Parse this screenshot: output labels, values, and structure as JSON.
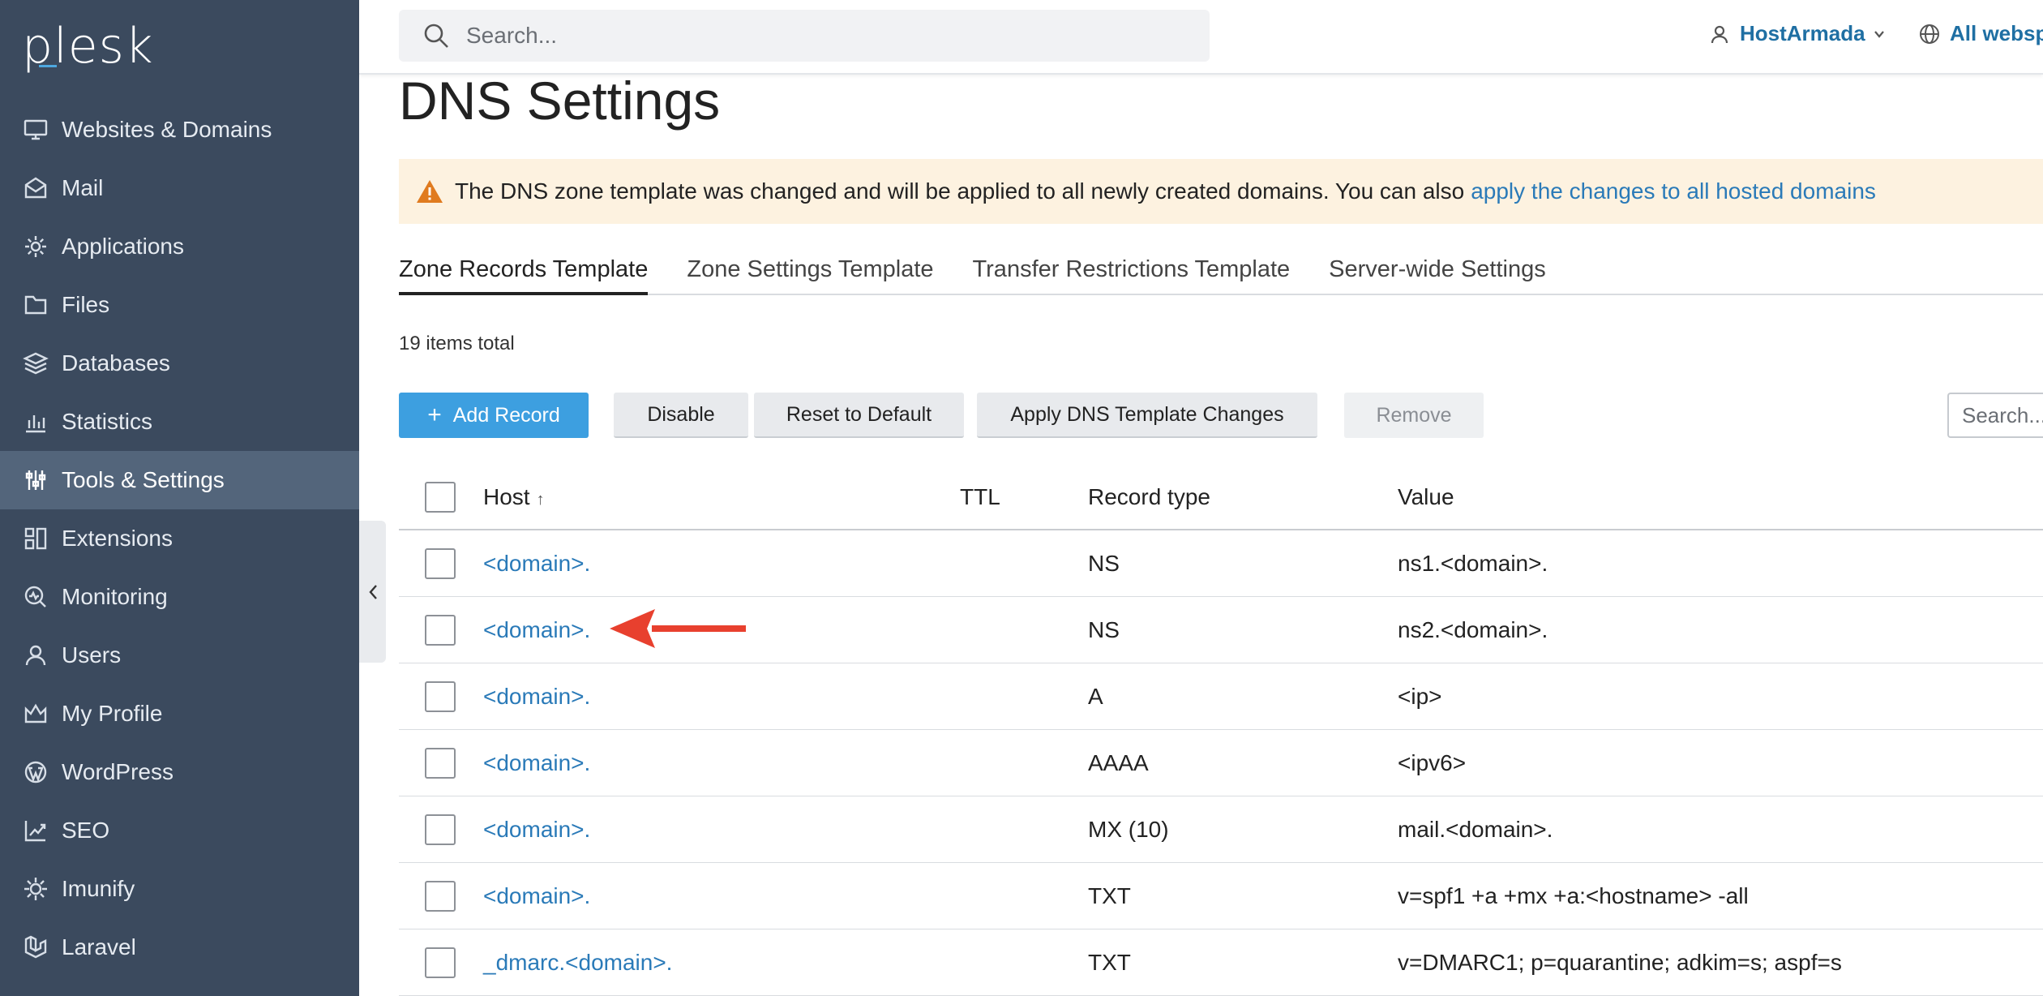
{
  "app": {
    "logo": "plesk"
  },
  "sidebar": {
    "items": [
      {
        "label": "Websites & Domains",
        "icon": "monitor-icon"
      },
      {
        "label": "Mail",
        "icon": "mail-icon"
      },
      {
        "label": "Applications",
        "icon": "gear-icon"
      },
      {
        "label": "Files",
        "icon": "folder-icon"
      },
      {
        "label": "Databases",
        "icon": "layers-icon"
      },
      {
        "label": "Statistics",
        "icon": "bar-chart-icon"
      },
      {
        "label": "Tools & Settings",
        "icon": "sliders-icon",
        "active": true
      },
      {
        "label": "Extensions",
        "icon": "grid-icon"
      },
      {
        "label": "Monitoring",
        "icon": "monitoring-icon"
      },
      {
        "label": "Users",
        "icon": "user-icon"
      },
      {
        "label": "My Profile",
        "icon": "crown-icon"
      },
      {
        "label": "WordPress",
        "icon": "wordpress-icon"
      },
      {
        "label": "SEO",
        "icon": "seo-chart-icon"
      },
      {
        "label": "Imunify",
        "icon": "imunify-gear-icon"
      },
      {
        "label": "Laravel",
        "icon": "laravel-icon"
      }
    ]
  },
  "topbar": {
    "search_placeholder": "Search...",
    "user": "HostArmada",
    "webspaces": "All webspaces"
  },
  "page": {
    "title": "DNS Settings",
    "warning_text": "The DNS zone template was changed and will be applied to all newly created domains. You can also",
    "warning_link": "apply the changes to all hosted domains",
    "tabs": [
      {
        "label": "Zone Records Template",
        "active": true
      },
      {
        "label": "Zone Settings Template"
      },
      {
        "label": "Transfer Restrictions Template"
      },
      {
        "label": "Server-wide Settings"
      }
    ],
    "items_total": "19 items total"
  },
  "toolbar": {
    "add_record": "Add Record",
    "disable": "Disable",
    "reset_default": "Reset to Default",
    "apply_changes": "Apply DNS Template Changes",
    "remove": "Remove",
    "search_placeholder": "Search..."
  },
  "table": {
    "columns": {
      "host": "Host",
      "ttl": "TTL",
      "type": "Record type",
      "value": "Value"
    },
    "sort_indicator": "↑",
    "rows": [
      {
        "host": "<domain>.",
        "ttl": "",
        "type": "NS",
        "value": "ns1.<domain>."
      },
      {
        "host": "<domain>.",
        "ttl": "",
        "type": "NS",
        "value": "ns2.<domain>."
      },
      {
        "host": "<domain>.",
        "ttl": "",
        "type": "A",
        "value": "<ip>"
      },
      {
        "host": "<domain>.",
        "ttl": "",
        "type": "AAAA",
        "value": "<ipv6>"
      },
      {
        "host": "<domain>.",
        "ttl": "",
        "type": "MX (10)",
        "value": "mail.<domain>."
      },
      {
        "host": "<domain>.",
        "ttl": "",
        "type": "TXT",
        "value": "v=spf1 +a +mx +a:<hostname> -all"
      },
      {
        "host": "_dmarc.<domain>.",
        "ttl": "",
        "type": "TXT",
        "value": "v=DMARC1; p=quarantine; adkim=s; aspf=s"
      }
    ]
  },
  "colors": {
    "sidebar_bg": "#3b4a5e",
    "sidebar_active": "#53657b",
    "primary_button": "#3d9fe0",
    "link": "#2a7ab8",
    "warning_bg": "#fdf2e0",
    "warning_icon": "#e07b1f",
    "annotation_arrow": "#e8402e"
  }
}
